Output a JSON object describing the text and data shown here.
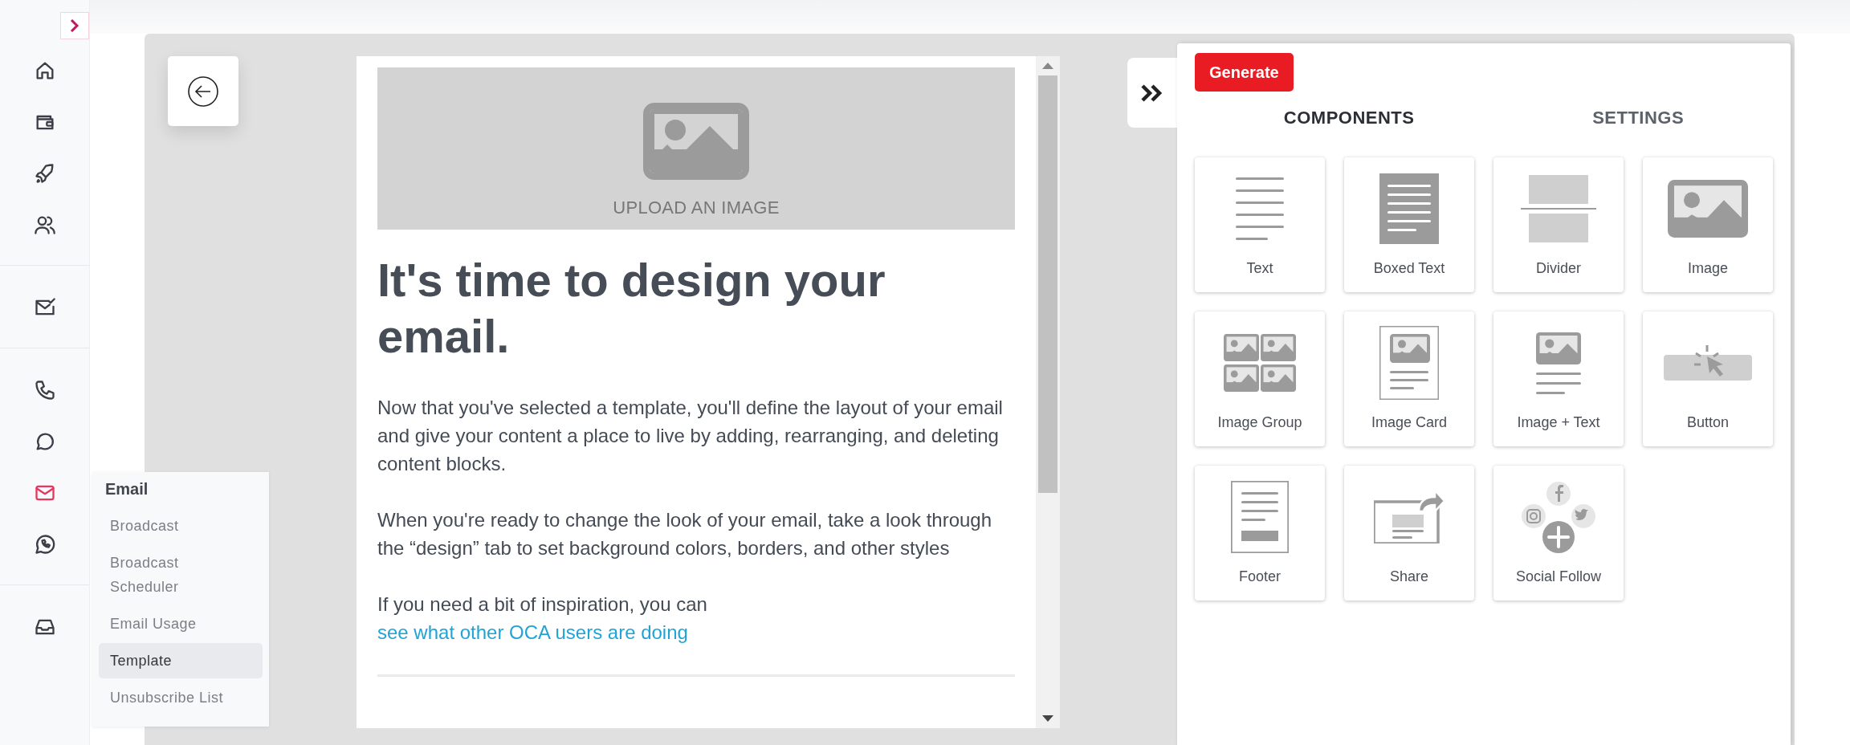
{
  "sidebar": {
    "groups": [
      {
        "items": [
          {
            "kind": "home",
            "selected": false
          },
          {
            "kind": "wallet",
            "selected": false
          },
          {
            "kind": "rocket",
            "selected": false
          },
          {
            "kind": "users",
            "selected": false
          }
        ]
      },
      {
        "items": [
          {
            "kind": "mail-check",
            "selected": false
          }
        ]
      },
      {
        "items": [
          {
            "kind": "phone",
            "selected": false
          },
          {
            "kind": "chat",
            "selected": false
          },
          {
            "kind": "mail",
            "selected": true
          },
          {
            "kind": "whatsapp",
            "selected": false
          }
        ]
      },
      {
        "items": [
          {
            "kind": "inbox",
            "selected": false
          }
        ]
      }
    ]
  },
  "flyout": {
    "title": "Email",
    "items": [
      {
        "label": "Broadcast",
        "selected": false
      },
      {
        "label": "Broadcast Scheduler",
        "selected": false
      },
      {
        "label": "Email Usage",
        "selected": false
      },
      {
        "label": "Template",
        "selected": true
      },
      {
        "label": "Unsubscribe List",
        "selected": false
      }
    ]
  },
  "editor": {
    "image_placeholder": "UPLOAD AN IMAGE",
    "heading": "It's time to design your email.",
    "paragraphs": [
      {
        "text": "Now that you've selected a template, you'll define the layout of your email and give your content a place to live by adding, rearranging, and deleting content blocks."
      },
      {
        "text": "When you're ready to change the look of your email, take a look through the “design” tab to set background colors, borders, and other styles"
      },
      {
        "text": "If you need a bit of inspiration, you can ",
        "link": "see what other OCA users are doing"
      }
    ]
  },
  "panel": {
    "generate": "Generate",
    "tabs": [
      {
        "label": "COMPONENTS",
        "selected": true
      },
      {
        "label": "SETTINGS",
        "selected": false
      }
    ],
    "components": [
      {
        "kind": "text",
        "label": "Text"
      },
      {
        "kind": "boxed-text",
        "label": "Boxed Text"
      },
      {
        "kind": "divider",
        "label": "Divider"
      },
      {
        "kind": "image",
        "label": "Image"
      },
      {
        "kind": "image-group",
        "label": "Image Group"
      },
      {
        "kind": "image-card",
        "label": "Image Card"
      },
      {
        "kind": "image-text",
        "label": "Image + Text"
      },
      {
        "kind": "button",
        "label": "Button"
      },
      {
        "kind": "footer",
        "label": "Footer"
      },
      {
        "kind": "share",
        "label": "Share"
      },
      {
        "kind": "social-follow",
        "label": "Social Follow"
      }
    ]
  }
}
